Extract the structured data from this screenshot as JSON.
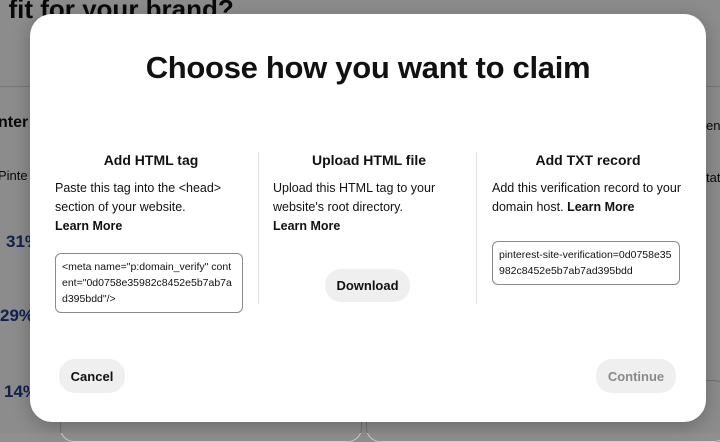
{
  "background": {
    "heading": "l fit for your brand?",
    "left_label_1": "nter",
    "left_label_2": "Pinte",
    "right_label_1": "en",
    "right_label_2": "tat",
    "stats": [
      "31%",
      "29%",
      "14%"
    ]
  },
  "modal": {
    "title": "Choose how you want to claim",
    "options": [
      {
        "title": "Add HTML tag",
        "description": "Paste this tag into the <head> section of your website.",
        "learn_more": "Learn More",
        "code": "<meta name=\"p:domain_verify\" content=\"0d0758e35982c8452e5b7ab7ad395bdd\"/>"
      },
      {
        "title": "Upload HTML file",
        "description": "Upload this HTML tag to your website's root directory.",
        "learn_more": "Learn More",
        "button": "Download"
      },
      {
        "title": "Add TXT record",
        "description": "Add this verification record to your domain host.",
        "learn_more": "Learn More",
        "code": "pinterest-site-verification=0d0758e35982c8452e5b7ab7ad395bdd"
      }
    ],
    "cancel": "Cancel",
    "continue": "Continue"
  }
}
